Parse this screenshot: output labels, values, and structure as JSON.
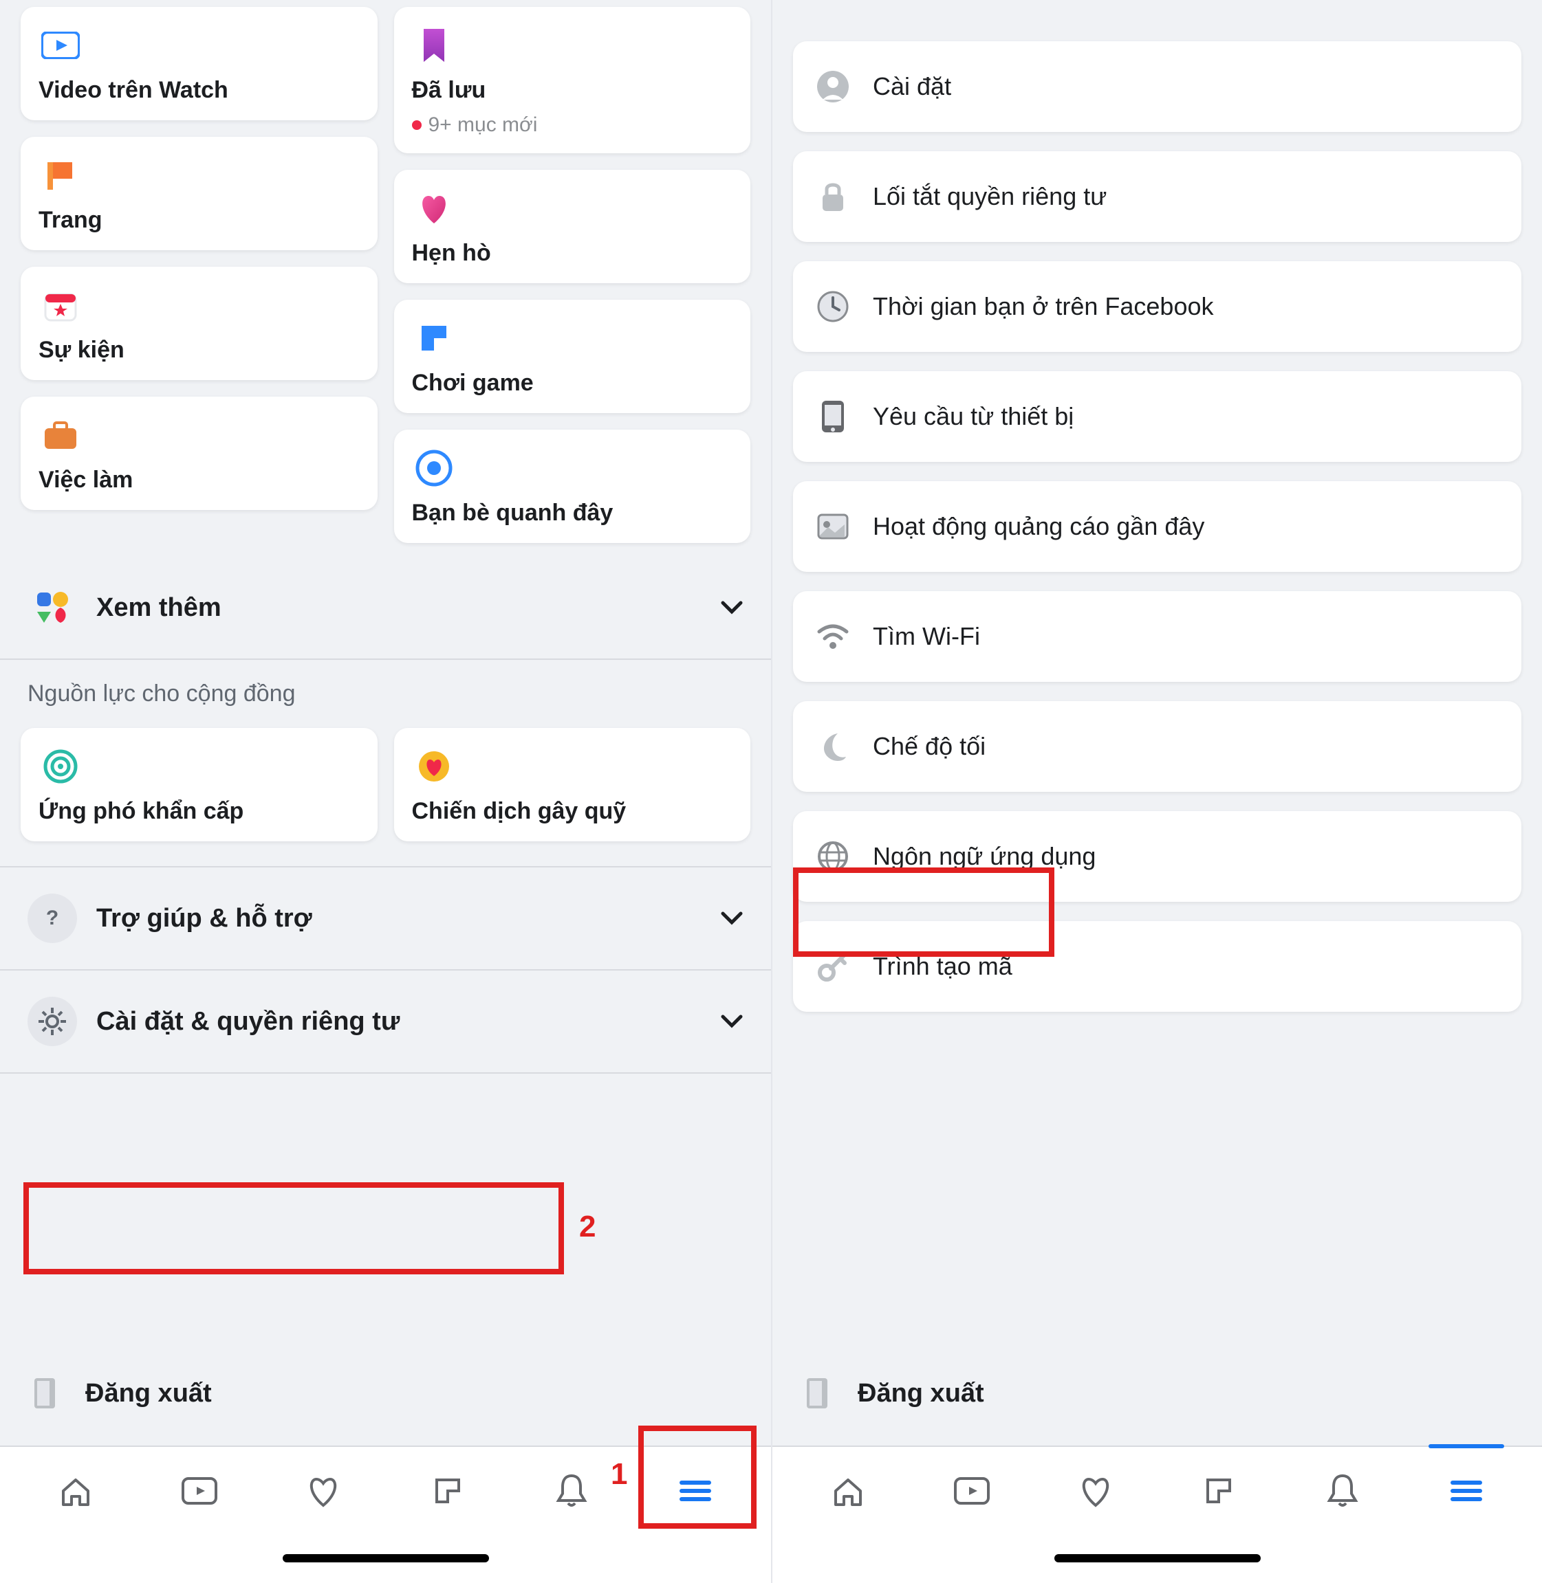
{
  "left": {
    "grid": {
      "colA": [
        {
          "label": "Video trên Watch",
          "icon": "watch"
        },
        {
          "label": "Trang",
          "icon": "flag"
        },
        {
          "label": "Sự kiện",
          "icon": "event"
        },
        {
          "label": "Việc làm",
          "icon": "job"
        }
      ],
      "colB": [
        {
          "label": "Đã lưu",
          "icon": "saved",
          "sub": "9+ mục mới"
        },
        {
          "label": "Hẹn hò",
          "icon": "dating"
        },
        {
          "label": "Chơi game",
          "icon": "gaming"
        },
        {
          "label": "Bạn bè quanh đây",
          "icon": "nearby"
        }
      ]
    },
    "see_more": "Xem thêm",
    "community_title": "Nguồn lực cho cộng đồng",
    "community": [
      {
        "label": "Ứng phó khẩn cấp",
        "icon": "emergency"
      },
      {
        "label": "Chiến dịch gây quỹ",
        "icon": "fundraiser"
      }
    ],
    "rows": [
      {
        "label": "Trợ giúp & hỗ trợ",
        "icon": "help"
      },
      {
        "label": "Cài đặt & quyền riêng tư",
        "icon": "gear"
      }
    ],
    "logout": "Đăng xuất",
    "annotations": {
      "one": "1",
      "two": "2"
    }
  },
  "right": {
    "items": [
      {
        "label": "Cài đặt",
        "icon": "user"
      },
      {
        "label": "Lối tắt quyền riêng tư",
        "icon": "lock"
      },
      {
        "label": "Thời gian bạn ở trên Facebook",
        "icon": "clock"
      },
      {
        "label": "Yêu cầu từ thiết bị",
        "icon": "device"
      },
      {
        "label": "Hoạt động quảng cáo gần đây",
        "icon": "ads"
      },
      {
        "label": "Tìm Wi-Fi",
        "icon": "wifi"
      },
      {
        "label": "Chế độ tối",
        "icon": "moon"
      },
      {
        "label": "Ngôn ngữ ứng dụng",
        "icon": "globe"
      },
      {
        "label": "Trình tạo mã",
        "icon": "key"
      }
    ],
    "logout": "Đăng xuất"
  }
}
